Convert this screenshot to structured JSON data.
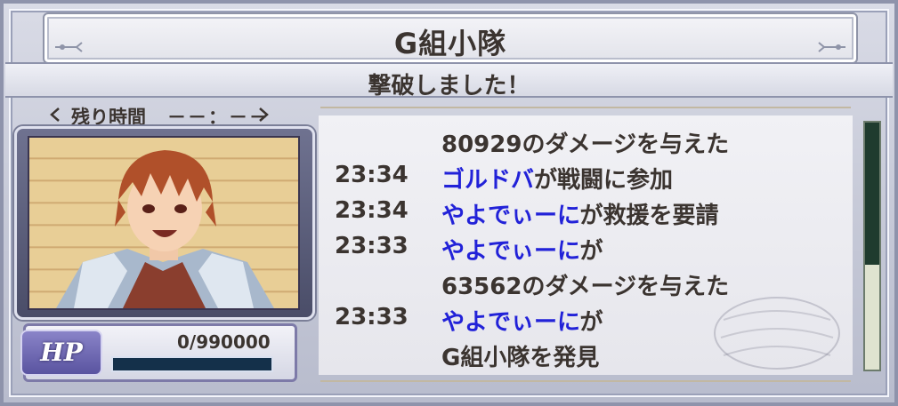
{
  "header": {
    "title": "G組小隊"
  },
  "status": {
    "message": "撃破しました！"
  },
  "timer": {
    "label": "残り時間",
    "value": "－－：－－"
  },
  "hp": {
    "badge": "HP",
    "value": "0/990000",
    "fraction": 0
  },
  "log": {
    "rows": [
      {
        "time": "",
        "name": "",
        "text": "80929のダメージを与えた"
      },
      {
        "time": "23:34",
        "name": "ゴルドバ",
        "text": "が戦闘に参加"
      },
      {
        "time": "23:34",
        "name": "やよでぃーに",
        "text": "が救援を要請"
      },
      {
        "time": "23:33",
        "name": "やよでぃーに",
        "text": "が"
      },
      {
        "time": "",
        "name": "",
        "text": "63562のダメージを与えた"
      },
      {
        "time": "23:33",
        "name": "やよでぃーに",
        "text": "が"
      },
      {
        "time": "",
        "name": "",
        "text": "G組小隊を発見"
      }
    ]
  },
  "colors": {
    "player_name": "#2222d8",
    "text": "#3b3430",
    "hp_badge": "#6a64b8"
  }
}
